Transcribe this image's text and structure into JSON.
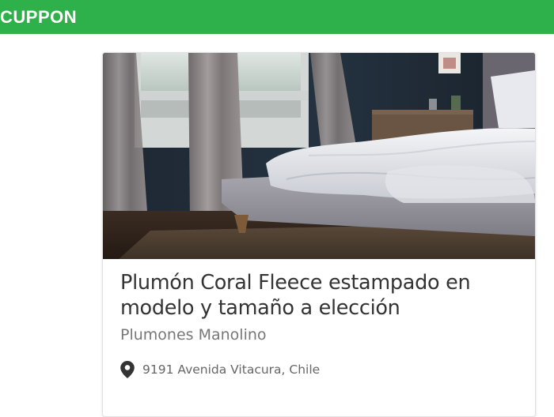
{
  "header": {
    "brand": "CUPPON",
    "brand_color": "#2eb04a"
  },
  "deal_card": {
    "image_alt_subject": "bedroom-bed-photo",
    "title": "Plumón Coral Fleece estampado en modelo y tamaño a elección",
    "merchant": "Plumones Manolino",
    "location_icon": "map-pin-icon",
    "address": "9191 Avenida Vitacura, Chile"
  }
}
